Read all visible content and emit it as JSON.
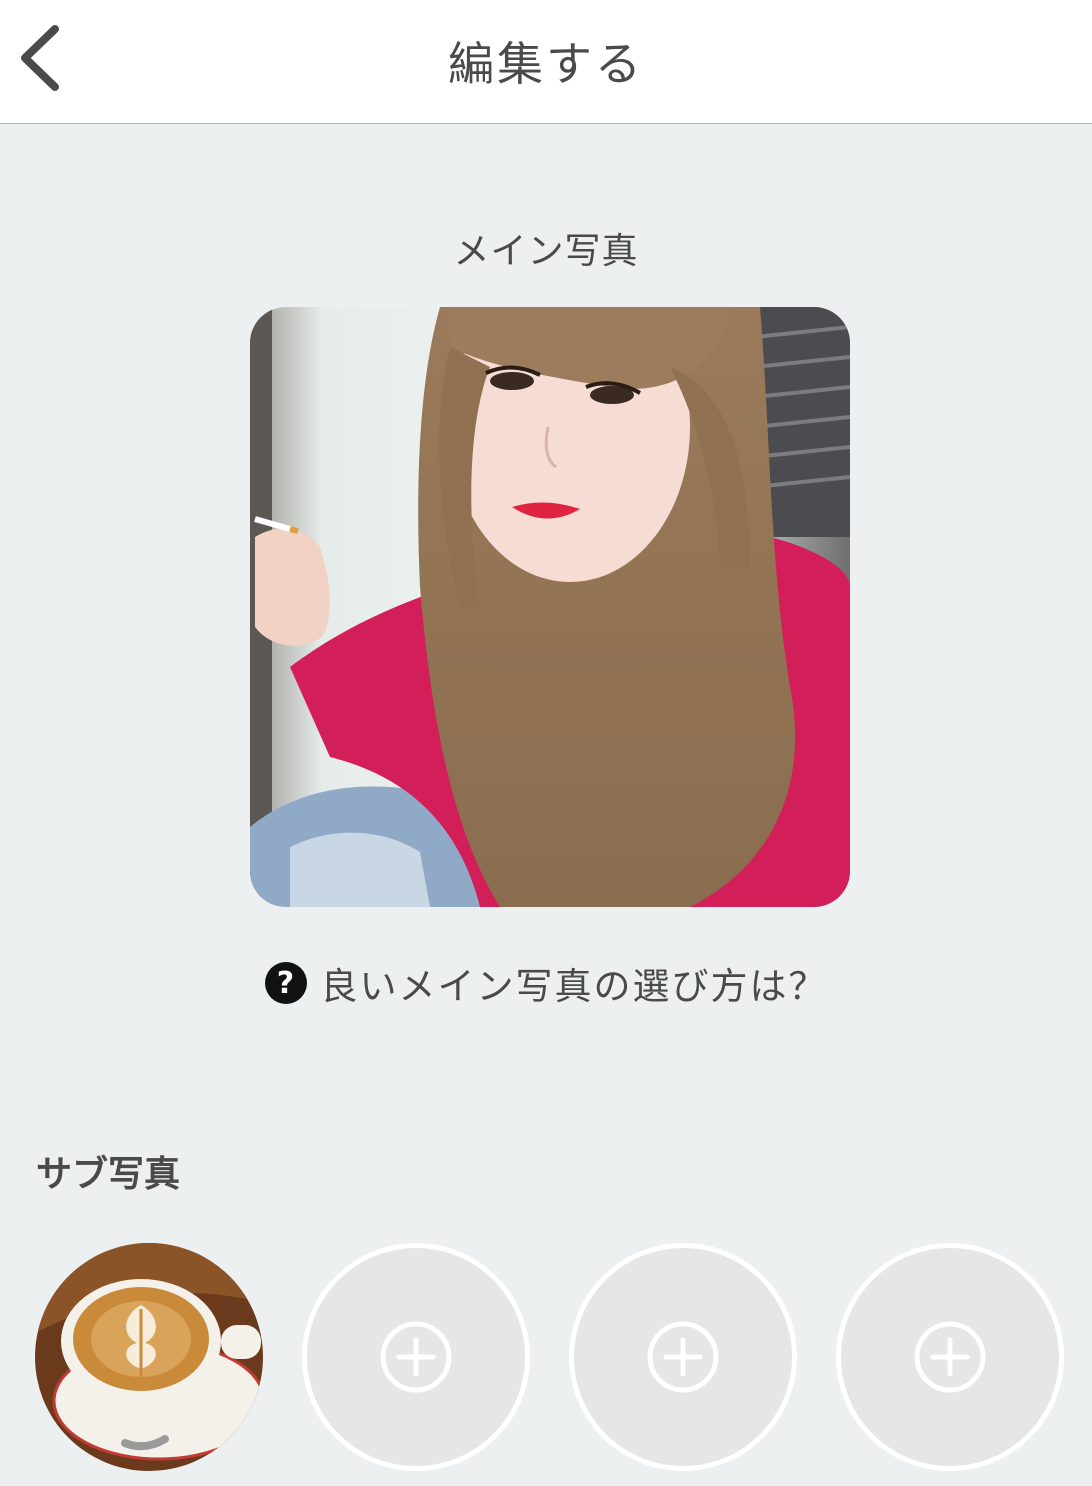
{
  "header": {
    "title": "編集する",
    "back_icon": "chevron-left-icon"
  },
  "main_photo": {
    "section_title": "メイン写真",
    "help_icon": "question-circle-icon",
    "help_text": "良いメイン写真の選び方は？"
  },
  "sub_photos": {
    "section_title": "サブ写真",
    "slots": [
      {
        "state": "filled",
        "subject": "latte-art-coffee"
      },
      {
        "state": "empty",
        "icon": "plus-circle-icon"
      },
      {
        "state": "empty",
        "icon": "plus-circle-icon"
      },
      {
        "state": "empty",
        "icon": "plus-circle-icon"
      }
    ]
  },
  "colors": {
    "background": "#edf0f1",
    "header_bg": "#ffffff",
    "text": "#4a4a4a",
    "empty_slot": "#e6e6e6",
    "hoodie": "#d21f5a"
  }
}
